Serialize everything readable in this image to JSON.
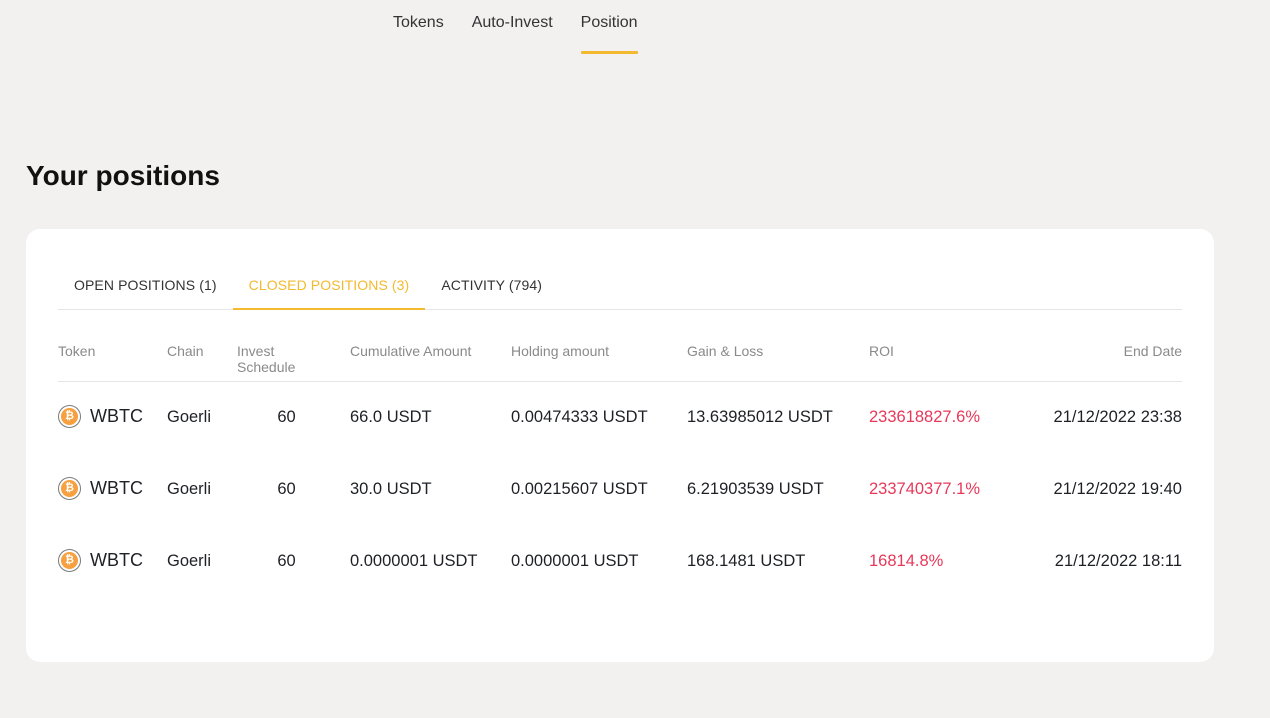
{
  "nav": {
    "items": [
      {
        "label": "Tokens"
      },
      {
        "label": "Auto-Invest"
      },
      {
        "label": "Position"
      }
    ],
    "active": "Position"
  },
  "page": {
    "title": "Your positions"
  },
  "tabs": [
    {
      "label": "OPEN POSITIONS (1)"
    },
    {
      "label": "CLOSED POSITIONS (3)"
    },
    {
      "label": "ACTIVITY (794)"
    }
  ],
  "active_tab": "CLOSED POSITIONS (3)",
  "table": {
    "headers": {
      "token": "Token",
      "chain": "Chain",
      "schedule": "Invest Schedule",
      "cumulative": "Cumulative Amount",
      "holding": "Holding amount",
      "gain_loss": "Gain & Loss",
      "roi": "ROI",
      "end_date": "End Date"
    },
    "rows": [
      {
        "token": "WBTC",
        "chain": "Goerli",
        "schedule": "60",
        "cumulative": "66.0 USDT",
        "holding": "0.00474333 USDT",
        "gain_loss": "13.63985012 USDT",
        "roi": "233618827.6%",
        "end_date": "21/12/2022 23:38"
      },
      {
        "token": "WBTC",
        "chain": "Goerli",
        "schedule": "60",
        "cumulative": "30.0 USDT",
        "holding": "0.00215607 USDT",
        "gain_loss": "6.21903539 USDT",
        "roi": "233740377.1%",
        "end_date": "21/12/2022 19:40"
      },
      {
        "token": "WBTC",
        "chain": "Goerli",
        "schedule": "60",
        "cumulative": "0.0000001 USDT",
        "holding": "0.0000001 USDT",
        "gain_loss": "168.1481 USDT",
        "roi": "16814.8%",
        "end_date": "21/12/2022 18:11"
      }
    ]
  },
  "icons": {
    "token_icon": "bitcoin-coin-icon",
    "token_icon_glyph": "₿"
  },
  "colors": {
    "accent": "#f3ba2f",
    "roi": "#e8385a",
    "coin": "#f7a040"
  }
}
